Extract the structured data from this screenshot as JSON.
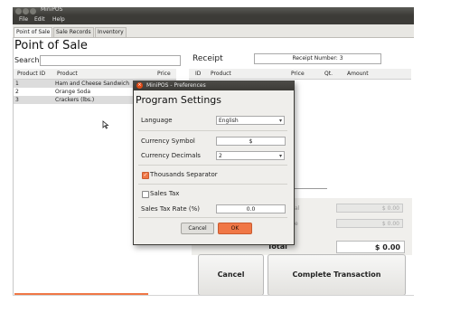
{
  "window": {
    "title": "MiniPOS"
  },
  "menu": [
    "File",
    "Edit",
    "Help"
  ],
  "tabs": [
    "Point of Sale",
    "Sale Records",
    "Inventory"
  ],
  "main": {
    "title": "Point of Sale",
    "search_label": "Search",
    "product_table": {
      "columns": [
        "Product ID",
        "Product",
        "Price"
      ],
      "rows": [
        {
          "id": "1",
          "product": "Ham and Cheese Sandwich"
        },
        {
          "id": "2",
          "product": "Orange Soda"
        },
        {
          "id": "3",
          "product": "Crackers (lbs.)"
        }
      ]
    }
  },
  "receipt": {
    "title": "Receipt",
    "number_label": "Receipt Number: 3",
    "columns": [
      "ID",
      "Product",
      "Price",
      "Qt.",
      "Amount"
    ],
    "subtotal_partial": "al",
    "tax_partial": "e",
    "subtotal_value": "$ 0.00",
    "tax_value": "$ 0.00",
    "total_label": "Total",
    "total_value": "$ 0.00",
    "cancel_label": "Cancel",
    "complete_label": "Complete Transaction"
  },
  "dialog": {
    "window_title": "MiniPOS - Preferences",
    "close_glyph": "×",
    "heading": "Program Settings",
    "language_label": "Language",
    "language_value": "English",
    "currency_symbol_label": "Currency Symbol",
    "currency_symbol_value": "$",
    "currency_decimals_label": "Currency Decimals",
    "currency_decimals_value": "2",
    "thousands_label": "Thousands Separator",
    "thousands_checked": true,
    "sales_tax_label": "Sales Tax",
    "sales_tax_checked": false,
    "sales_tax_rate_label": "Sales Tax Rate (%)",
    "sales_tax_rate_value": "0.0",
    "cancel_label": "Cancel",
    "ok_label": "OK"
  },
  "colors": {
    "accent": "#f07746",
    "titlebar": "#3c3b37"
  }
}
